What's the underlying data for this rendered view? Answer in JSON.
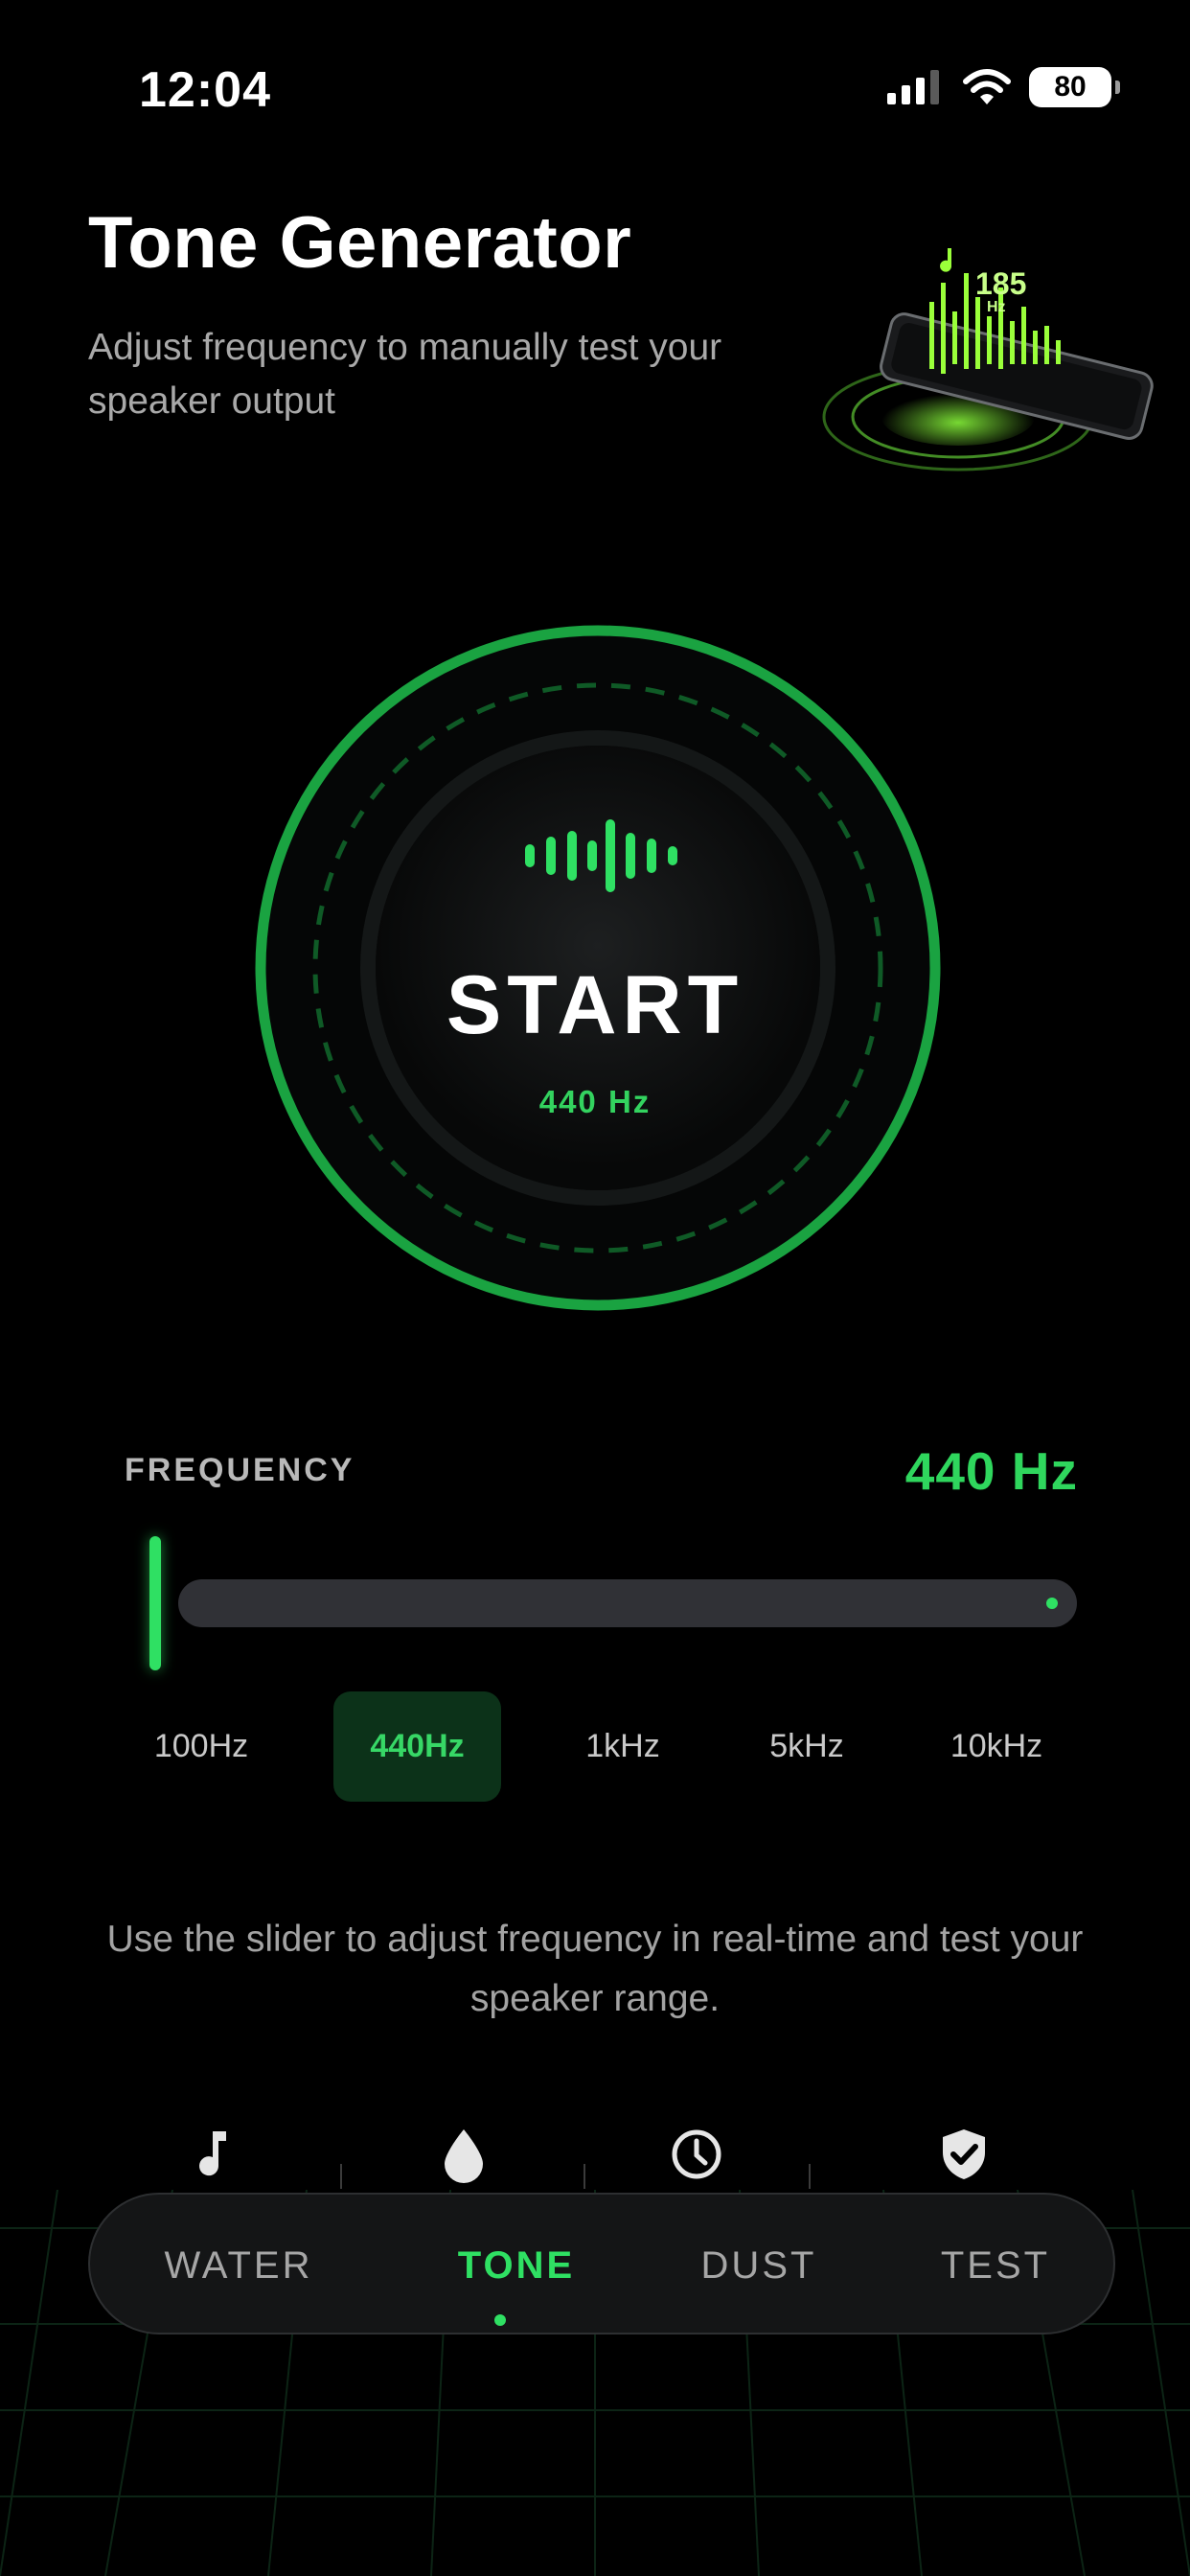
{
  "status_bar": {
    "time": "12:04",
    "battery": "80",
    "icons": [
      "signal-icon",
      "wifi-icon",
      "battery-icon"
    ]
  },
  "header": {
    "title": "Tone Generator",
    "subtitle": "Adjust frequency to manually test your speaker output",
    "hero_label": "185",
    "hero_unit": "Hz"
  },
  "start_button": {
    "label": "START",
    "frequency": "440 Hz",
    "icon": "sound-wave-icon"
  },
  "frequency": {
    "label": "FREQUENCY",
    "value": "440 Hz",
    "slider_fraction": 0.0
  },
  "presets": [
    {
      "label": "100Hz",
      "active": false
    },
    {
      "label": "440Hz",
      "active": true
    },
    {
      "label": "1kHz",
      "active": false
    },
    {
      "label": "5kHz",
      "active": false
    },
    {
      "label": "10kHz",
      "active": false
    }
  ],
  "hint": "Use the slider to adjust frequency in real-time and test your speaker range.",
  "nav_icons": [
    "music-note-icon",
    "water-drop-icon",
    "clock-icon",
    "shield-check-icon"
  ],
  "tabs": [
    {
      "label": "WATER",
      "active": false
    },
    {
      "label": "TONE",
      "active": true
    },
    {
      "label": "DUST",
      "active": false
    },
    {
      "label": "TEST",
      "active": false
    }
  ],
  "colors": {
    "accent": "#2fe063",
    "background": "#000000",
    "track": "#303136",
    "preset_active_bg": "#0c3219"
  }
}
